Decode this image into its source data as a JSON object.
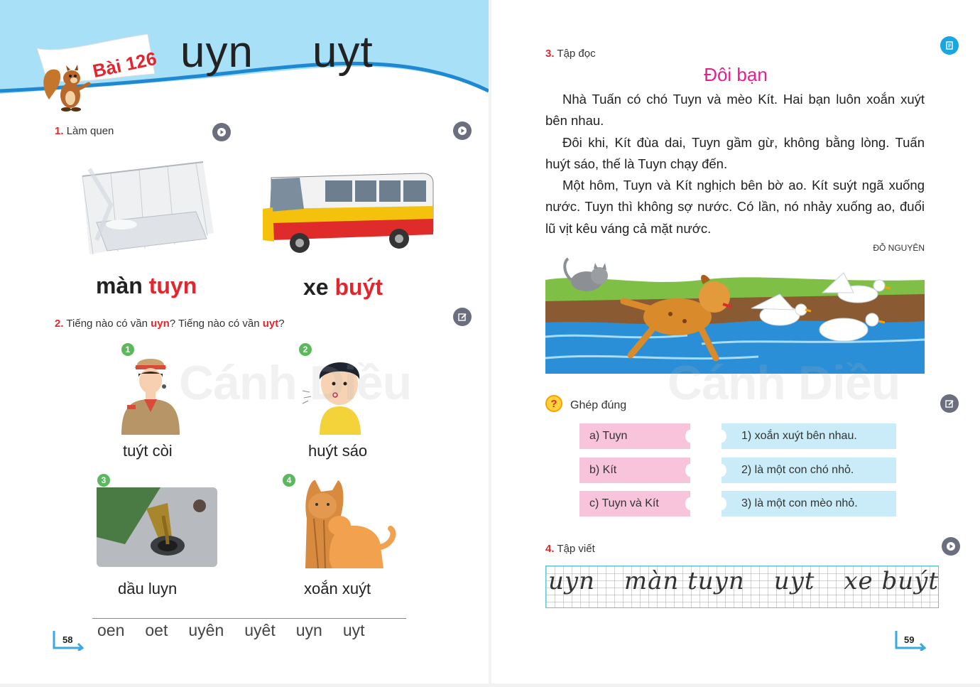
{
  "left_page": {
    "lesson_tag": "Bài 126",
    "rhymes": [
      "uyn",
      "uyt"
    ],
    "section1": {
      "number": "1.",
      "label": "Làm quen"
    },
    "section1_words": [
      {
        "base": "màn ",
        "highlight": "tuyn"
      },
      {
        "base": "xe ",
        "highlight": "buýt"
      }
    ],
    "section2": {
      "number": "2.",
      "part1": "Tiếng nào có vần ",
      "hl1": "uyn",
      "part2": "? Tiếng nào có vần ",
      "hl2": "uyt",
      "part3": "?"
    },
    "items": [
      {
        "badge": "1",
        "caption": "tuýt còi"
      },
      {
        "badge": "2",
        "caption": "huýt sáo"
      },
      {
        "badge": "3",
        "caption": "dầu luyn"
      },
      {
        "badge": "4",
        "caption": "xoắn xuýt"
      }
    ],
    "review_rhymes": [
      "oen",
      "oet",
      "uyên",
      "uyêt",
      "uyn",
      "uyt"
    ],
    "page_number": "58",
    "watermark": "Cánh Diều"
  },
  "right_page": {
    "section3": {
      "number": "3.",
      "label": "Tập đọc"
    },
    "story_title": "Đôi bạn",
    "paragraphs": [
      "Nhà Tuấn có chó Tuyn và mèo Kít. Hai bạn luôn xoắn xuýt bên nhau.",
      "Đôi khi, Kít đùa dai, Tuyn gầm gừ, không bằng lòng. Tuấn huýt sáo, thế là Tuyn chạy đến.",
      "Một hôm, Tuyn và Kít nghịch bên bờ ao. Kít suýt ngã xuống nước. Tuyn thì không sợ nước. Có lần, nó nhảy xuống ao, đuổi lũ vịt kêu váng cả mặt nước."
    ],
    "author": "ĐỖ NGUYÊN",
    "match": {
      "icon": "?",
      "label": "Ghép đúng",
      "left": [
        "a) Tuyn",
        "b) Kít",
        "c) Tuyn và Kít"
      ],
      "right": [
        "1) xoắn xuýt bên nhau.",
        "2) là một con chó nhỏ.",
        "3) là một con mèo nhỏ."
      ]
    },
    "section4": {
      "number": "4.",
      "label": "Tập viết"
    },
    "cursive": [
      "uyn",
      "màn tuyn",
      "uyt",
      "xe buýt"
    ],
    "page_number": "59",
    "watermark": "Cánh Diều"
  },
  "colors": {
    "header_sky": "#a8e0f7",
    "header_wave": "#1e88d2",
    "accent_red": "#e3262e",
    "story_pink": "#e91e8c",
    "pill_pink": "#f7c4dc",
    "pill_blue": "#c9ecf8",
    "badge_green": "#5cb85c"
  }
}
